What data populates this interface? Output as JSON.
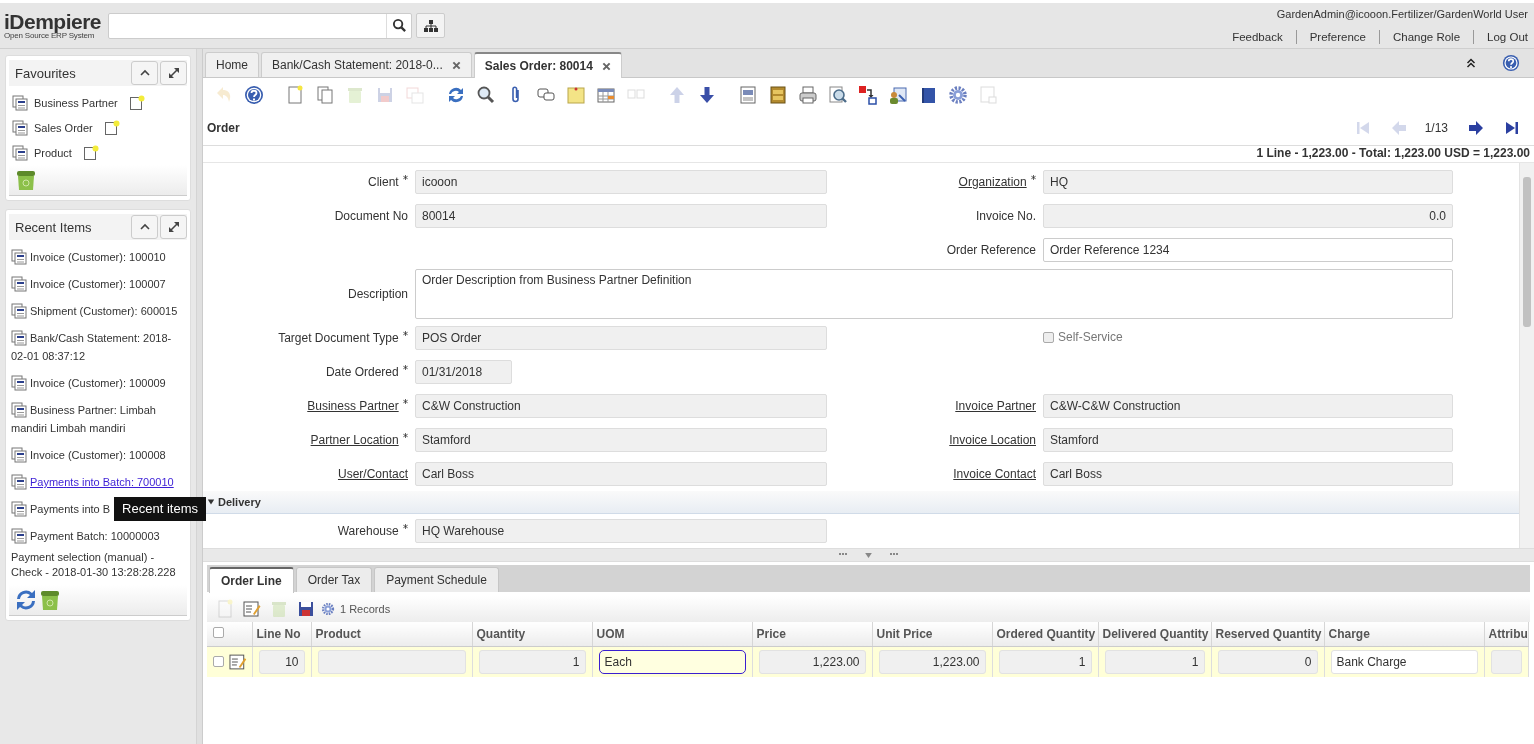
{
  "header": {
    "logo": {
      "name": "iDempiere",
      "tagline": "Open Source ERP System"
    },
    "user": "GardenAdmin@icooon.Fertilizer/GardenWorld User",
    "links": [
      "Feedback",
      "Preference",
      "Change Role",
      "Log Out"
    ]
  },
  "favourites": {
    "title": "Favourites",
    "items": [
      {
        "label": "Business Partner"
      },
      {
        "label": "Sales Order"
      },
      {
        "label": "Product"
      }
    ]
  },
  "recent_items": {
    "title": "Recent Items",
    "tooltip": "Recent items",
    "items": [
      {
        "label": "Invoice (Customer): 100010",
        "kind": "window"
      },
      {
        "label": "Invoice (Customer): 100007",
        "kind": "window"
      },
      {
        "label": "Shipment (Customer): 600015",
        "kind": "window"
      },
      {
        "label": "Bank/Cash Statement: 2018-02-01 08:37:12",
        "kind": "window"
      },
      {
        "label": "Invoice (Customer): 100009",
        "kind": "window"
      },
      {
        "label": "Business Partner: Limbah mandiri Limbah mandiri",
        "kind": "window"
      },
      {
        "label": "Invoice (Customer): 100008",
        "kind": "window"
      },
      {
        "label": "Payments into Batch: 700010",
        "kind": "link"
      },
      {
        "label": "Payments into B",
        "kind": "tooltip"
      },
      {
        "label": "Payment Batch: 10000003",
        "kind": "window"
      },
      {
        "label": "Payment selection (manual) - Check - 2018-01-30 13:28:28.228",
        "kind": "plain"
      }
    ]
  },
  "tabs": [
    {
      "label": "Home",
      "closable": false,
      "selected": false
    },
    {
      "label": "Bank/Cash Statement: 2018-0...",
      "closable": true,
      "selected": false
    },
    {
      "label": "Sales Order: 80014",
      "closable": true,
      "selected": true
    }
  ],
  "toolbar": [
    {
      "kind": "undo",
      "disabled": true
    },
    {
      "kind": "help",
      "disabled": false
    },
    {
      "kind": "gap"
    },
    {
      "kind": "new",
      "disabled": false
    },
    {
      "kind": "copy",
      "disabled": false
    },
    {
      "kind": "delete",
      "disabled": true
    },
    {
      "kind": "save",
      "disabled": true
    },
    {
      "kind": "savenew",
      "disabled": true
    },
    {
      "kind": "gap"
    },
    {
      "kind": "refresh",
      "disabled": false
    },
    {
      "kind": "find",
      "disabled": false
    },
    {
      "kind": "attachment",
      "disabled": false
    },
    {
      "kind": "chat",
      "disabled": false
    },
    {
      "kind": "note",
      "disabled": false
    },
    {
      "kind": "grid",
      "disabled": false
    },
    {
      "kind": "multi",
      "disabled": true
    },
    {
      "kind": "gap"
    },
    {
      "kind": "up",
      "disabled": true
    },
    {
      "kind": "down",
      "disabled": false
    },
    {
      "kind": "gap"
    },
    {
      "kind": "report",
      "disabled": false
    },
    {
      "kind": "archive",
      "disabled": false
    },
    {
      "kind": "print",
      "disabled": false
    },
    {
      "kind": "zoom",
      "disabled": false
    },
    {
      "kind": "workflow",
      "disabled": false
    },
    {
      "kind": "request",
      "disabled": false
    },
    {
      "kind": "product",
      "disabled": false
    },
    {
      "kind": "process",
      "disabled": false
    },
    {
      "kind": "customize",
      "disabled": true
    }
  ],
  "window_title": "Order",
  "navigation": {
    "record": "1/13",
    "buttons": [
      {
        "kind": "first",
        "disabled": true
      },
      {
        "kind": "previous",
        "disabled": true
      },
      {
        "kind": "next",
        "disabled": false
      },
      {
        "kind": "last",
        "disabled": false
      }
    ]
  },
  "summary": "1 Line - 1,223.00 - Total: 1,223.00 USD = 1,223.00",
  "form": {
    "rows": [
      {
        "kind": "fields",
        "left": {
          "label": "Client",
          "value": "icooon",
          "required": true,
          "link": false,
          "readonly": true,
          "kind": "text"
        },
        "right": {
          "label": "Organization",
          "value": "HQ",
          "required": true,
          "link": true,
          "readonly": true,
          "kind": "text"
        }
      },
      {
        "kind": "fields",
        "left": {
          "label": "Document No",
          "value": "80014",
          "required": false,
          "link": false,
          "readonly": true,
          "kind": "text"
        },
        "right": {
          "label": "Invoice No.",
          "value": "0.0",
          "required": false,
          "link": false,
          "readonly": true,
          "kind": "number"
        }
      },
      {
        "kind": "fields",
        "right": {
          "label": "Order Reference",
          "value": "Order Reference 1234",
          "required": false,
          "link": false,
          "readonly": false,
          "kind": "text"
        }
      },
      {
        "kind": "wide",
        "field": {
          "label": "Description",
          "value": "Order Description from Business Partner Definition",
          "required": false,
          "link": false,
          "readonly": false,
          "kind": "textarea"
        }
      },
      {
        "kind": "fields",
        "left": {
          "label": "Target Document Type",
          "value": "POS Order",
          "required": true,
          "link": false,
          "readonly": true,
          "kind": "text"
        },
        "right": {
          "label": "Self-Service",
          "kind": "checkbox",
          "checked": false,
          "disabled": true
        }
      },
      {
        "kind": "fields",
        "left": {
          "label": "Date Ordered",
          "value": "01/31/2018",
          "required": true,
          "link": false,
          "readonly": true,
          "kind": "date"
        }
      },
      {
        "kind": "fields",
        "left": {
          "label": "Business Partner",
          "value": "C&W Construction",
          "required": true,
          "link": true,
          "readonly": true,
          "kind": "text"
        },
        "right": {
          "label": "Invoice Partner",
          "value": "C&W-C&W Construction",
          "required": false,
          "link": true,
          "readonly": true,
          "kind": "text"
        }
      },
      {
        "kind": "fields",
        "left": {
          "label": "Partner Location",
          "value": "Stamford",
          "required": true,
          "link": true,
          "readonly": true,
          "kind": "text"
        },
        "right": {
          "label": "Invoice Location",
          "value": "Stamford",
          "required": false,
          "link": true,
          "readonly": true,
          "kind": "text"
        }
      },
      {
        "kind": "fields",
        "left": {
          "label": "User/Contact",
          "value": "Carl Boss",
          "required": false,
          "link": true,
          "readonly": true,
          "kind": "text"
        },
        "right": {
          "label": "Invoice Contact",
          "value": "Carl Boss",
          "required": false,
          "link": true,
          "readonly": true,
          "kind": "text"
        }
      },
      {
        "kind": "section",
        "label": "Delivery",
        "expanded": true
      },
      {
        "kind": "fields",
        "left": {
          "label": "Warehouse",
          "value": "HQ Warehouse",
          "required": true,
          "link": false,
          "readonly": true,
          "kind": "text"
        }
      }
    ]
  },
  "detail_tabs": [
    {
      "label": "Order Line",
      "selected": true
    },
    {
      "label": "Order Tax",
      "selected": false
    },
    {
      "label": "Payment Schedule",
      "selected": false
    }
  ],
  "grid_toolbar": {
    "buttons": [
      {
        "kind": "new",
        "disabled": true
      },
      {
        "kind": "edit",
        "disabled": false
      },
      {
        "kind": "delete",
        "disabled": true
      },
      {
        "kind": "save",
        "disabled": false
      }
    ],
    "record_count": "1 Records"
  },
  "grid": {
    "select_all_checked": false,
    "columns": [
      "Line No",
      "Product",
      "Quantity",
      "UOM",
      "Price",
      "Unit Price",
      "Ordered Quantity",
      "Delivered Quantity",
      "Reserved Quantity",
      "Charge",
      "Attribu"
    ],
    "rows": [
      {
        "selected": true,
        "checked": false,
        "cells": [
          {
            "value": "10",
            "kind": "number",
            "readonly": true,
            "focused": false
          },
          {
            "kind": "text",
            "readonly": true,
            "focused": false
          },
          {
            "value": "1",
            "kind": "number",
            "readonly": true,
            "focused": false
          },
          {
            "value": "Each",
            "kind": "text",
            "readonly": false,
            "focused": true
          },
          {
            "value": "1,223.00",
            "kind": "number",
            "readonly": true,
            "focused": false
          },
          {
            "value": "1,223.00",
            "kind": "number",
            "readonly": true,
            "focused": false
          },
          {
            "value": "1",
            "kind": "number",
            "readonly": true,
            "focused": false
          },
          {
            "value": "1",
            "kind": "number",
            "readonly": true,
            "focused": false
          },
          {
            "value": "0",
            "kind": "number",
            "readonly": true,
            "focused": false
          },
          {
            "value": "Bank Charge",
            "kind": "text",
            "readonly": false,
            "focused": false
          },
          {
            "kind": "text",
            "readonly": true,
            "focused": false
          }
        ]
      }
    ]
  }
}
